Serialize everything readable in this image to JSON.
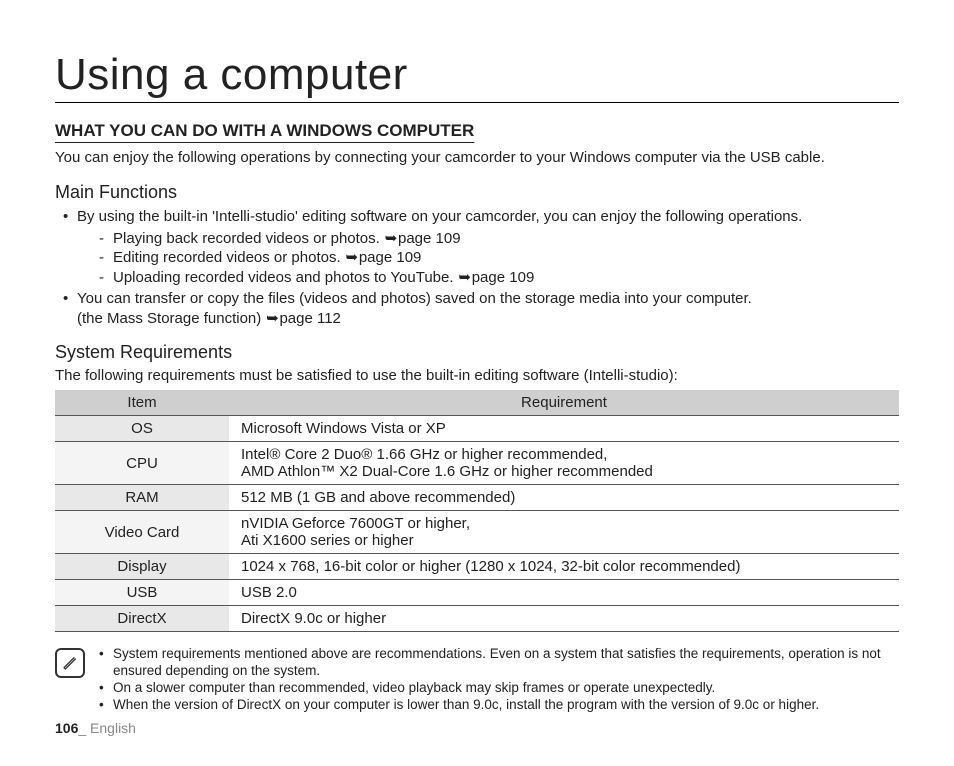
{
  "title": "Using a computer",
  "section_head": "WHAT YOU CAN DO WITH A WINDOWS COMPUTER",
  "intro": "You can enjoy the following operations by connecting your camcorder to your Windows computer via the USB cable.",
  "main_functions": {
    "heading": "Main Functions",
    "b1": "By using the built-in 'Intelli-studio' editing software on your camcorder, you can enjoy the following operations.",
    "s1": "Playing back recorded videos or photos.",
    "s1ref": "page 109",
    "s2": "Editing recorded videos or photos.",
    "s2ref": "page 109",
    "s3": "Uploading recorded videos and photos to YouTube.",
    "s3ref": "page 109",
    "b2a": "You can transfer or copy the files (videos and photos) saved on the storage media into your computer.",
    "b2b": "(the Mass Storage function)",
    "b2ref": "page 112"
  },
  "sysreq": {
    "heading": "System Requirements",
    "intro": "The following requirements must be satisfied to use the built-in editing software (Intelli-studio):",
    "col_item": "Item",
    "col_req": "Requirement",
    "rows": [
      {
        "item": "OS",
        "req": "Microsoft Windows Vista or XP"
      },
      {
        "item": "CPU",
        "req": "Intel® Core 2 Duo® 1.66 GHz or higher recommended,\nAMD Athlon™ X2 Dual-Core 1.6 GHz or higher recommended"
      },
      {
        "item": "RAM",
        "req": "512 MB (1 GB and above recommended)"
      },
      {
        "item": "Video Card",
        "req": "nVIDIA Geforce 7600GT or higher,\nAti X1600 series or higher"
      },
      {
        "item": "Display",
        "req": "1024 x 768, 16-bit color or higher (1280 x 1024, 32-bit color recommended)"
      },
      {
        "item": "USB",
        "req": "USB 2.0"
      },
      {
        "item": "DirectX",
        "req": "DirectX 9.0c or higher"
      }
    ]
  },
  "notes": {
    "n1": "System requirements mentioned above are recommendations. Even on a system that satisfies the requirements, operation is not ensured depending on the system.",
    "n2": "On a slower computer than recommended, video playback may skip frames or operate unexpectedly.",
    "n3": "When the version of DirectX on your computer is lower than 9.0c, install the program with the version of 9.0c or higher."
  },
  "footer": {
    "page": "106",
    "sep": "_ ",
    "lang": "English"
  }
}
